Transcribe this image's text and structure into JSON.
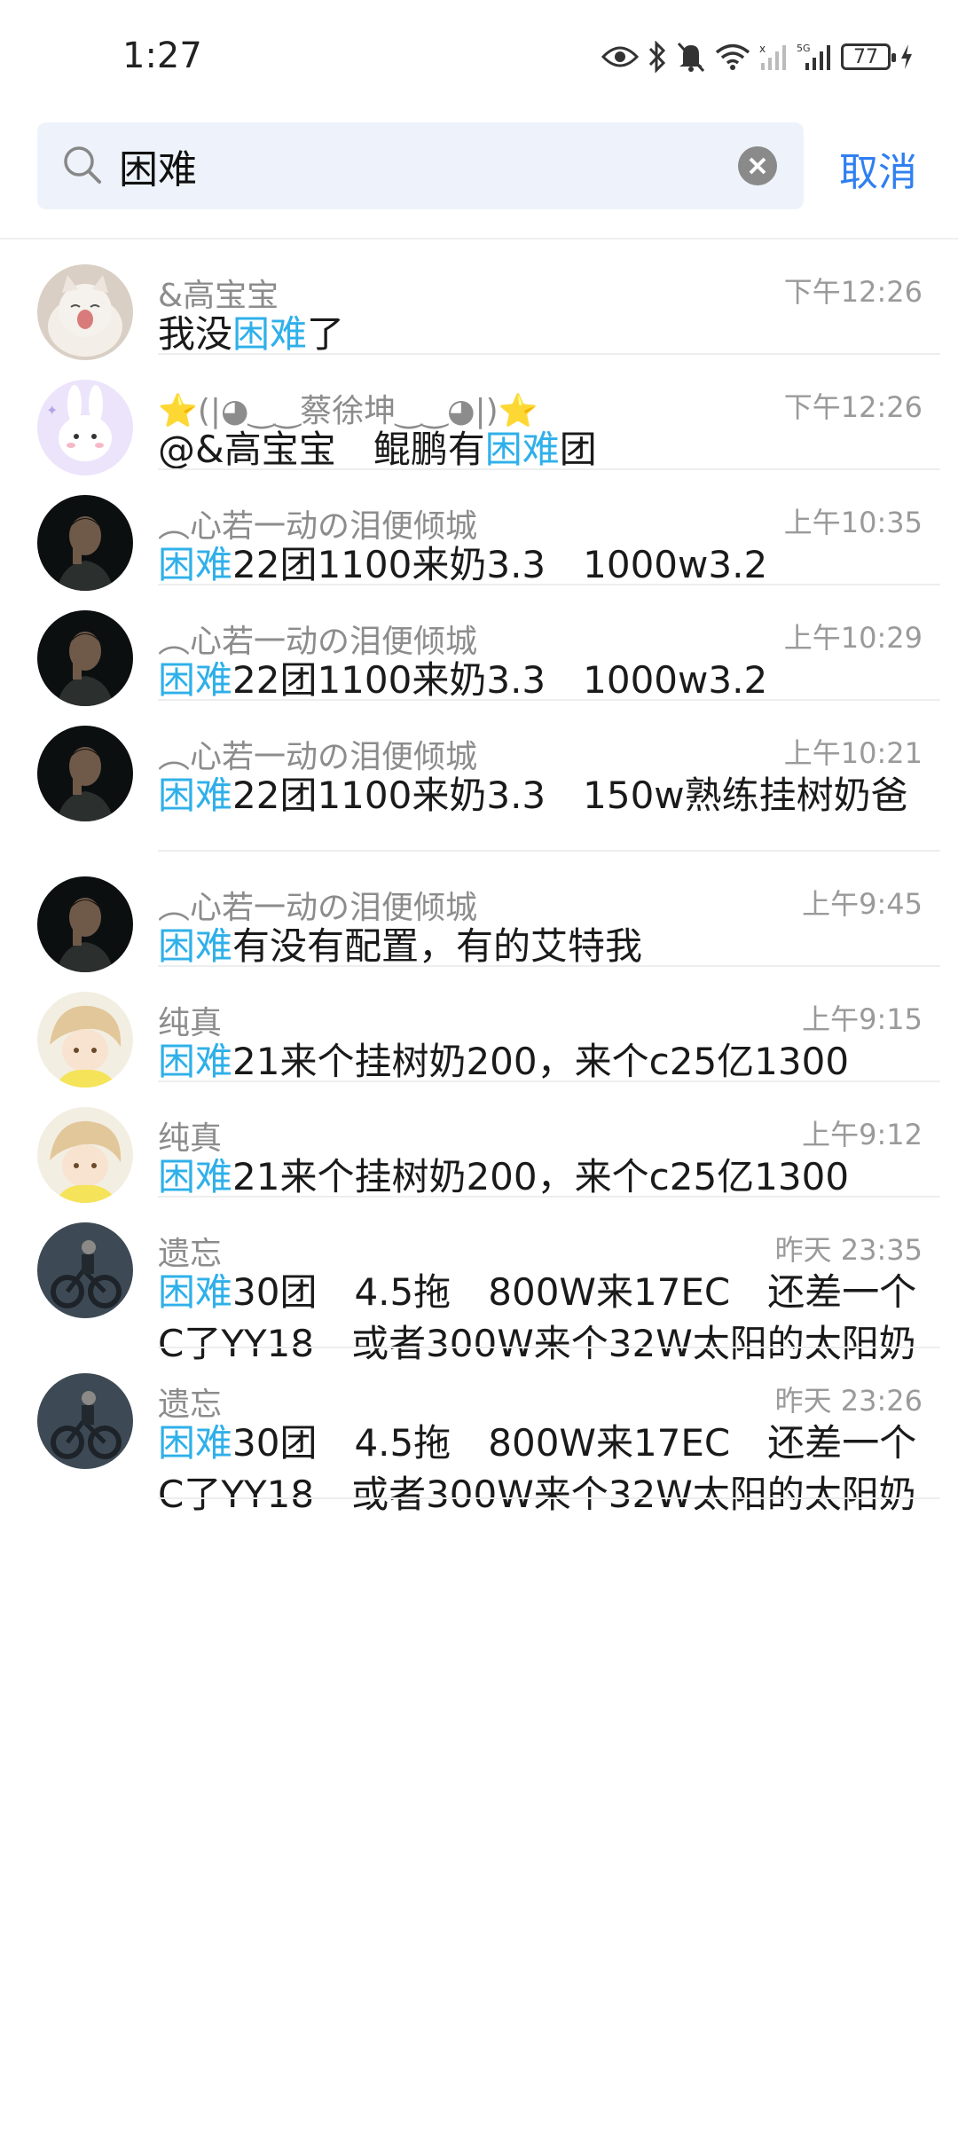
{
  "status_bar": {
    "time": "1:27",
    "battery_level": "77",
    "icons": [
      "eye-icon",
      "bluetooth-icon",
      "mute-icon",
      "wifi-icon",
      "signal-icon",
      "5g-signal-icon",
      "battery-icon",
      "charging-icon"
    ],
    "network_label": "5G"
  },
  "search": {
    "query": "困难",
    "placeholder": "",
    "cancel_label": "取消",
    "accent_color": "#2f7ff1",
    "highlight_color": "#2fb0ea"
  },
  "results": [
    {
      "name": "&高宝宝",
      "time": "下午12:26",
      "pre": "我没",
      "hl": "困难",
      "post": "了",
      "avatar": "cat-avatar"
    },
    {
      "name": "⭐(|◕‿‿蔡徐坤‿‿◕|)⭐",
      "time": "下午12:26",
      "pre": "@&高宝宝　鲲鹏有",
      "hl": "困难",
      "post": "团",
      "avatar": "bunny-avatar"
    },
    {
      "name": "︵心若一动の泪便倾城",
      "time": "上午10:35",
      "pre": "",
      "hl": "困难",
      "post": "22团1100来奶3.3　1000w3.2",
      "avatar": "person-avatar"
    },
    {
      "name": "︵心若一动の泪便倾城",
      "time": "上午10:29",
      "pre": "",
      "hl": "困难",
      "post": "22团1100来奶3.3　1000w3.2",
      "avatar": "person-avatar"
    },
    {
      "name": "︵心若一动の泪便倾城",
      "time": "上午10:21",
      "pre": "",
      "hl": "困难",
      "post": "22团1100来奶3.3　150w熟练挂树奶爸",
      "avatar": "person-avatar"
    },
    {
      "name": "︵心若一动の泪便倾城",
      "time": "上午9:45",
      "pre": "",
      "hl": "困难",
      "post": "有没有配置，有的艾特我",
      "avatar": "person-avatar"
    },
    {
      "name": "纯真",
      "time": "上午9:15",
      "pre": "",
      "hl": "困难",
      "post": "21来个挂树奶200，来个c25亿1300",
      "avatar": "anime-avatar"
    },
    {
      "name": "纯真",
      "time": "上午9:12",
      "pre": "",
      "hl": "困难",
      "post": "21来个挂树奶200，来个c25亿1300",
      "avatar": "anime-avatar"
    },
    {
      "name": "遗忘",
      "time": "昨天 23:35",
      "pre": "",
      "hl": "困难",
      "post": "30团　4.5拖　800W来17EC　还差一个C了YY18　或者300W来个32W太阳的太阳奶",
      "avatar": "bike-avatar"
    },
    {
      "name": "遗忘",
      "time": "昨天 23:26",
      "pre": "",
      "hl": "困难",
      "post": "30团　4.5拖　800W来17EC　还差一个C了YY18　或者300W来个32W太阳的太阳奶",
      "avatar": "bike-avatar"
    }
  ]
}
